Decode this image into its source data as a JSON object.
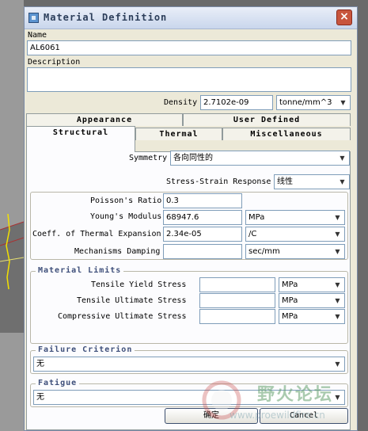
{
  "dialog": {
    "title": "Material Definition",
    "close_glyph": "×"
  },
  "name": {
    "label": "Name",
    "value": "AL6061"
  },
  "description": {
    "label": "Description",
    "value": ""
  },
  "density": {
    "label": "Density",
    "value": "2.7102e-09",
    "unit": "tonne/mm^3"
  },
  "tabs": {
    "row1": [
      "Appearance",
      "User Defined"
    ],
    "row2": [
      "Structural",
      "Thermal",
      "Miscellaneous"
    ],
    "active": "Structural"
  },
  "structural": {
    "symmetry": {
      "label": "Symmetry",
      "value": "各向同性的"
    },
    "stress_strain": {
      "label": "Stress-Strain Response",
      "value": "线性"
    },
    "poisson": {
      "label": "Poisson's Ratio",
      "value": "0.3"
    },
    "youngs": {
      "label": "Young's Modulus",
      "value": "68947.6",
      "unit": "MPa"
    },
    "thermal_exp": {
      "label": "Coeff. of Thermal Expansion",
      "value": "2.34e-05",
      "unit": "/C"
    },
    "damping": {
      "label": "Mechanisms Damping",
      "value": "",
      "unit": "sec/mm"
    }
  },
  "material_limits": {
    "title": "Material Limits",
    "tensile_yield": {
      "label": "Tensile Yield Stress",
      "value": "",
      "unit": "MPa"
    },
    "tensile_ultimate": {
      "label": "Tensile Ultimate Stress",
      "value": "",
      "unit": "MPa"
    },
    "compressive_ultimate": {
      "label": "Compressive Ultimate Stress",
      "value": "",
      "unit": "MPa"
    }
  },
  "failure": {
    "title": "Failure Criterion",
    "value": "无"
  },
  "fatigue": {
    "title": "Fatigue",
    "value": "无"
  },
  "buttons": {
    "ok": "确定",
    "cancel": "Cancel"
  },
  "watermark": {
    "text": "野火论坛",
    "url": "www.proewildfire.cn"
  },
  "arrow_glyph": "▼",
  "colors": {
    "title_text": "#2c3e5a",
    "group_title": "#3e4f7a",
    "close": "#c8553d"
  }
}
